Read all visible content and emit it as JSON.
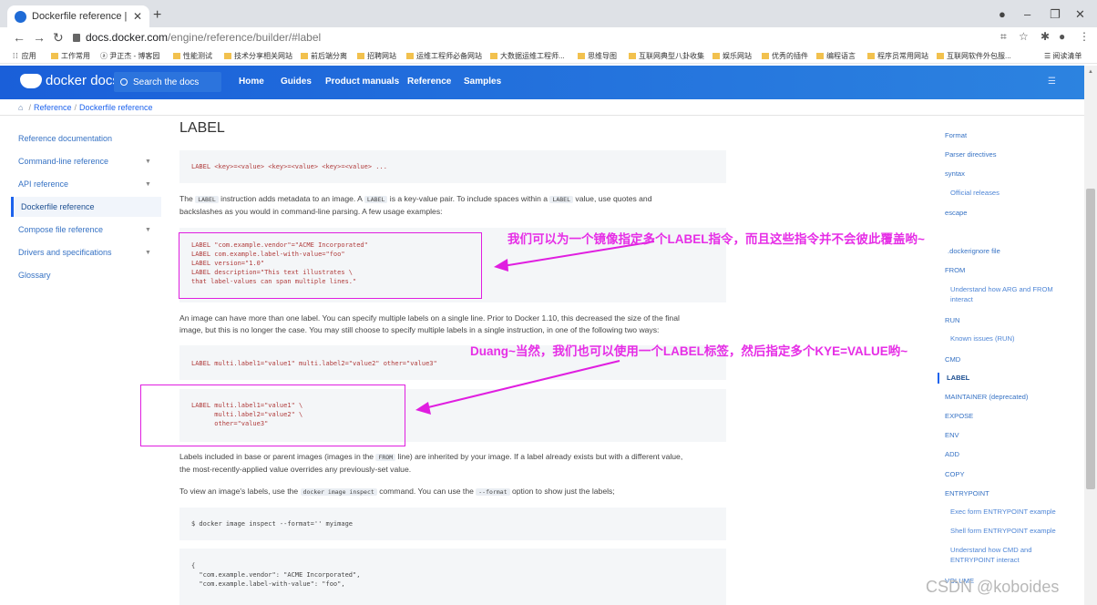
{
  "browser": {
    "tab_title": "Dockerfile reference | Docker",
    "url_host": "docs.docker.com",
    "url_path": "/engine/reference/builder/#label",
    "bookmarks": [
      "应用",
      "工作常用",
      "尹正杰 - 博客园",
      "性能测试",
      "技术分享相关网站",
      "前后端分离",
      "招聘网站",
      "运维工程师必备网站",
      "大数据运维工程师...",
      "思维导图",
      "互联网典型八卦收集",
      "娱乐网站",
      "优秀的插件",
      "编程语言",
      "程序员常用网站",
      "互联网软件外包服...",
      "阅读清单"
    ]
  },
  "header": {
    "logo_text": "docker docs",
    "search_placeholder": "Search the docs",
    "nav": [
      "Home",
      "Guides",
      "Product manuals",
      "Reference",
      "Samples"
    ]
  },
  "breadcrumb": [
    "Reference",
    "Dockerfile reference"
  ],
  "sidebar": {
    "items": [
      {
        "label": "Reference documentation",
        "caret": false
      },
      {
        "label": "Command-line reference",
        "caret": true
      },
      {
        "label": "API reference",
        "caret": true
      },
      {
        "label": "Dockerfile reference",
        "caret": false,
        "active": true
      },
      {
        "label": "Compose file reference",
        "caret": true
      },
      {
        "label": "Drivers and specifications",
        "caret": true
      },
      {
        "label": "Glossary",
        "caret": false
      }
    ]
  },
  "main": {
    "heading": "LABEL",
    "code1": [
      "LABEL <key>=<value> <key>=<value> <key>=<value> ..."
    ],
    "para1": {
      "t1": "The ",
      "c1": "LABEL",
      "t2": " instruction adds metadata to an image. A ",
      "c2": "LABEL",
      "t3": " is a key-value pair. To include spaces within a ",
      "c3": "LABEL",
      "t4": " value, use quotes and",
      "t5": "backslashes as you would in command-line parsing. A few usage examples:"
    },
    "code2": [
      "LABEL \"com.example.vendor\"=\"ACME Incorporated\"",
      "LABEL com.example.label-with-value=\"foo\"",
      "LABEL version=\"1.0\"",
      "LABEL description=\"This text illustrates \\",
      "that label-values can span multiple lines.\""
    ],
    "para2": [
      "An image can have more than one label. You can specify multiple labels on a single line. Prior to Docker 1.10, this decreased the size of the final",
      "image, but this is no longer the case. You may still choose to specify multiple labels in a single instruction, in one of the following two ways:"
    ],
    "code3": [
      "LABEL multi.label1=\"value1\" multi.label2=\"value2\" other=\"value3\""
    ],
    "code4": [
      "LABEL multi.label1=\"value1\" \\",
      "      multi.label2=\"value2\" \\",
      "      other=\"value3\""
    ],
    "para3": {
      "t1": "Labels included in base or parent images (images in the ",
      "c1": "FROM",
      "t2": " line) are inherited by your image. If a label already exists but with a different value,",
      "t3": "the most-recently-applied value overrides any previously-set value."
    },
    "para4": {
      "t1": "To view an image's labels, use the ",
      "c1": "docker image inspect",
      "t2": " command. You can use the ",
      "c2": "--format",
      "t3": " option to show just the labels;"
    },
    "code5": [
      "$ docker image inspect --format='' myimage"
    ],
    "code6": [
      "{",
      "  \"com.example.vendor\": \"ACME Incorporated\",",
      "  \"com.example.label-with-value\": \"foo\","
    ]
  },
  "annotations": {
    "note1": "我们可以为一个镜像指定多个LABEL指令，而且这些指令并不会彼此覆盖哟~",
    "note2": "Duang~当然，我们也可以使用一个LABEL标签，然后指定多个KYE=VALUE哟~"
  },
  "toc": [
    {
      "label": "Format",
      "sub": false
    },
    {
      "label": "Parser directives",
      "sub": false
    },
    {
      "label": "syntax",
      "sub": false
    },
    {
      "label": "Official releases",
      "sub": true
    },
    {
      "label": "escape",
      "sub": false
    },
    {
      "label": ".dockerignore file",
      "sub": false
    },
    {
      "label": "FROM",
      "sub": false
    },
    {
      "label": "Understand how ARG and FROM",
      "sub": true
    },
    {
      "label": "interact",
      "sub": true
    },
    {
      "label": "RUN",
      "sub": false
    },
    {
      "label": "Known issues (RUN)",
      "sub": true
    },
    {
      "label": "CMD",
      "sub": false
    },
    {
      "label": "LABEL",
      "sub": false,
      "active": true
    },
    {
      "label": "MAINTAINER (deprecated)",
      "sub": false
    },
    {
      "label": "EXPOSE",
      "sub": false
    },
    {
      "label": "ENV",
      "sub": false
    },
    {
      "label": "ADD",
      "sub": false
    },
    {
      "label": "COPY",
      "sub": false
    },
    {
      "label": "ENTRYPOINT",
      "sub": false
    },
    {
      "label": "Exec form ENTRYPOINT example",
      "sub": true
    },
    {
      "label": "Shell form ENTRYPOINT example",
      "sub": true
    },
    {
      "label": "Understand how CMD and",
      "sub": true
    },
    {
      "label": "ENTRYPOINT interact",
      "sub": true
    },
    {
      "label": "VOLUME",
      "sub": false
    }
  ],
  "watermark": "CSDN @koboides",
  "colors": {
    "header": "#1d63ed",
    "annotation": "#e01ee0",
    "link": "#3672c4"
  }
}
